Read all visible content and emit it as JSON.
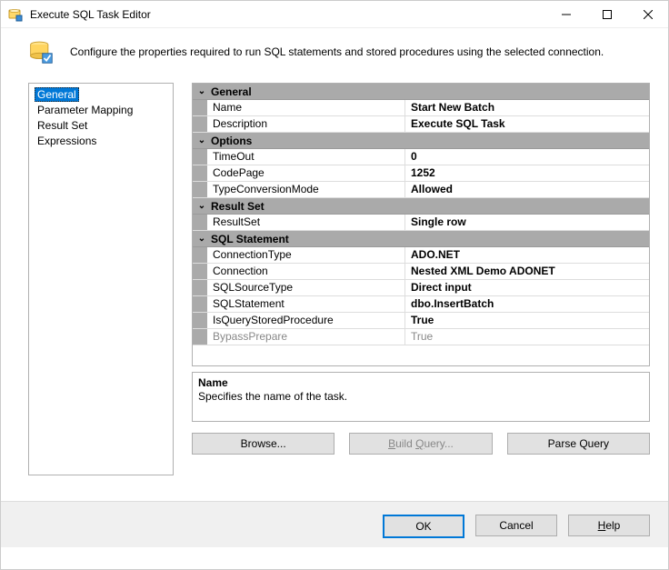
{
  "window": {
    "title": "Execute SQL Task Editor"
  },
  "header": {
    "description": "Configure the properties required to run SQL statements and stored procedures using the selected connection."
  },
  "nav": {
    "items": [
      {
        "label": "General",
        "selected": true
      },
      {
        "label": "Parameter Mapping",
        "selected": false
      },
      {
        "label": "Result Set",
        "selected": false
      },
      {
        "label": "Expressions",
        "selected": false
      }
    ]
  },
  "propertyGrid": {
    "sections": [
      {
        "header": "General",
        "rows": [
          {
            "label": "Name",
            "value": "Start New Batch"
          },
          {
            "label": "Description",
            "value": "Execute SQL Task"
          }
        ]
      },
      {
        "header": "Options",
        "rows": [
          {
            "label": "TimeOut",
            "value": "0"
          },
          {
            "label": "CodePage",
            "value": "1252"
          },
          {
            "label": "TypeConversionMode",
            "value": "Allowed"
          }
        ]
      },
      {
        "header": "Result Set",
        "rows": [
          {
            "label": "ResultSet",
            "value": "Single row"
          }
        ]
      },
      {
        "header": "SQL Statement",
        "rows": [
          {
            "label": "ConnectionType",
            "value": "ADO.NET"
          },
          {
            "label": "Connection",
            "value": "Nested XML Demo ADONET"
          },
          {
            "label": "SQLSourceType",
            "value": "Direct input"
          },
          {
            "label": "SQLStatement",
            "value": "dbo.InsertBatch"
          },
          {
            "label": "IsQueryStoredProcedure",
            "value": "True"
          },
          {
            "label": "BypassPrepare",
            "value": "True",
            "disabled": true
          }
        ]
      }
    ],
    "help": {
      "title": "Name",
      "text": "Specifies the name of the task."
    }
  },
  "actions": {
    "browse": "Browse...",
    "buildQuery": "Build Query...",
    "parseQuery": "Parse Query"
  },
  "footer": {
    "ok": "OK",
    "cancel": "Cancel",
    "help": "Help"
  }
}
